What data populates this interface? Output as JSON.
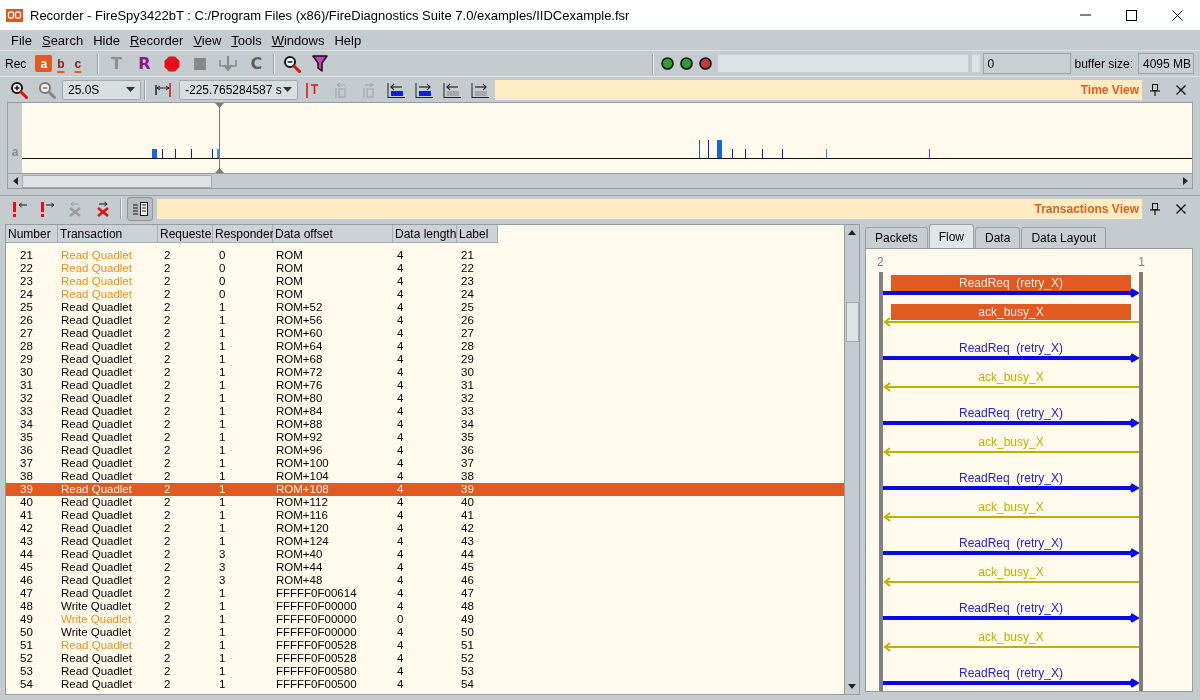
{
  "window": {
    "title": "Recorder - FireSpy3422bT : C:/Program Files (x86)/FireDiagnostics Suite 7.0/examples/IIDCexample.fsr"
  },
  "menu": [
    {
      "label": "File",
      "underlined": false
    },
    {
      "label": "Search",
      "underlined": true
    },
    {
      "label": "Hide",
      "underlined": false
    },
    {
      "label": "Recorder",
      "underlined": true
    },
    {
      "label": "View",
      "underlined": true
    },
    {
      "label": "Tools",
      "underlined": true
    },
    {
      "label": "Windows",
      "underlined": true
    },
    {
      "label": "Help",
      "underlined": false
    }
  ],
  "record_toolbar": {
    "label": "Rec",
    "channels": [
      {
        "label": "a",
        "selected": true
      },
      {
        "label": "b",
        "selected": false
      },
      {
        "label": "c",
        "selected": false
      }
    ],
    "tools": [
      {
        "kind": "letter",
        "label": "T",
        "color": "#8e8e8e"
      },
      {
        "kind": "letter",
        "label": "R",
        "color": "#86198a"
      },
      {
        "kind": "record"
      },
      {
        "kind": "stop"
      },
      {
        "kind": "download"
      },
      {
        "kind": "letter",
        "label": "C",
        "color": "#5c5c5c"
      },
      {
        "kind": "separator"
      },
      {
        "kind": "search"
      },
      {
        "kind": "filter"
      }
    ]
  },
  "status": {
    "leds": [
      {
        "color": "#2f9e35"
      },
      {
        "color": "#2f9e35"
      },
      {
        "color": "#c03a3a"
      }
    ],
    "counter": "0",
    "buffer_label": "buffer size:",
    "buffer_value": "4095 MB"
  },
  "time_view": {
    "zoom": "25.0S",
    "position": "-225.765284587 s",
    "title": "Time View",
    "track_label": "a"
  },
  "transactions": {
    "title": "Transactions View",
    "columns": [
      "Number",
      "Transaction",
      "Requeste",
      "Responder",
      "Data offset",
      "Data length",
      "Label"
    ],
    "rows": [
      {
        "cells": [
          "21",
          "Read Quadlet",
          "2",
          "0",
          "ROM",
          "4",
          "21"
        ],
        "kind": "retry",
        "selected": false
      },
      {
        "cells": [
          "22",
          "Read Quadlet",
          "2",
          "0",
          "ROM",
          "4",
          "22"
        ],
        "kind": "retry",
        "selected": false
      },
      {
        "cells": [
          "23",
          "Read Quadlet",
          "2",
          "0",
          "ROM",
          "4",
          "23"
        ],
        "kind": "retry",
        "selected": false
      },
      {
        "cells": [
          "24",
          "Read Quadlet",
          "2",
          "0",
          "ROM",
          "4",
          "24"
        ],
        "kind": "retry",
        "selected": false
      },
      {
        "cells": [
          "25",
          "Read Quadlet",
          "2",
          "1",
          "ROM+52",
          "4",
          "25"
        ],
        "kind": "normal",
        "selected": false
      },
      {
        "cells": [
          "26",
          "Read Quadlet",
          "2",
          "1",
          "ROM+56",
          "4",
          "26"
        ],
        "kind": "normal",
        "selected": false
      },
      {
        "cells": [
          "27",
          "Read Quadlet",
          "2",
          "1",
          "ROM+60",
          "4",
          "27"
        ],
        "kind": "normal",
        "selected": false
      },
      {
        "cells": [
          "28",
          "Read Quadlet",
          "2",
          "1",
          "ROM+64",
          "4",
          "28"
        ],
        "kind": "normal",
        "selected": false
      },
      {
        "cells": [
          "29",
          "Read Quadlet",
          "2",
          "1",
          "ROM+68",
          "4",
          "29"
        ],
        "kind": "normal",
        "selected": false
      },
      {
        "cells": [
          "30",
          "Read Quadlet",
          "2",
          "1",
          "ROM+72",
          "4",
          "30"
        ],
        "kind": "normal",
        "selected": false
      },
      {
        "cells": [
          "31",
          "Read Quadlet",
          "2",
          "1",
          "ROM+76",
          "4",
          "31"
        ],
        "kind": "normal",
        "selected": false
      },
      {
        "cells": [
          "32",
          "Read Quadlet",
          "2",
          "1",
          "ROM+80",
          "4",
          "32"
        ],
        "kind": "normal",
        "selected": false
      },
      {
        "cells": [
          "33",
          "Read Quadlet",
          "2",
          "1",
          "ROM+84",
          "4",
          "33"
        ],
        "kind": "normal",
        "selected": false
      },
      {
        "cells": [
          "34",
          "Read Quadlet",
          "2",
          "1",
          "ROM+88",
          "4",
          "34"
        ],
        "kind": "normal",
        "selected": false
      },
      {
        "cells": [
          "35",
          "Read Quadlet",
          "2",
          "1",
          "ROM+92",
          "4",
          "35"
        ],
        "kind": "normal",
        "selected": false
      },
      {
        "cells": [
          "36",
          "Read Quadlet",
          "2",
          "1",
          "ROM+96",
          "4",
          "36"
        ],
        "kind": "normal",
        "selected": false
      },
      {
        "cells": [
          "37",
          "Read Quadlet",
          "2",
          "1",
          "ROM+100",
          "4",
          "37"
        ],
        "kind": "normal",
        "selected": false
      },
      {
        "cells": [
          "38",
          "Read Quadlet",
          "2",
          "1",
          "ROM+104",
          "4",
          "38"
        ],
        "kind": "normal",
        "selected": false
      },
      {
        "cells": [
          "39",
          "Read Quadlet",
          "2",
          "1",
          "ROM+108",
          "4",
          "39"
        ],
        "kind": "normal",
        "selected": true
      },
      {
        "cells": [
          "40",
          "Read Quadlet",
          "2",
          "1",
          "ROM+112",
          "4",
          "40"
        ],
        "kind": "normal",
        "selected": false
      },
      {
        "cells": [
          "41",
          "Read Quadlet",
          "2",
          "1",
          "ROM+116",
          "4",
          "41"
        ],
        "kind": "normal",
        "selected": false
      },
      {
        "cells": [
          "42",
          "Read Quadlet",
          "2",
          "1",
          "ROM+120",
          "4",
          "42"
        ],
        "kind": "normal",
        "selected": false
      },
      {
        "cells": [
          "43",
          "Read Quadlet",
          "2",
          "1",
          "ROM+124",
          "4",
          "43"
        ],
        "kind": "normal",
        "selected": false
      },
      {
        "cells": [
          "44",
          "Read Quadlet",
          "2",
          "3",
          "ROM+40",
          "4",
          "44"
        ],
        "kind": "normal",
        "selected": false
      },
      {
        "cells": [
          "45",
          "Read Quadlet",
          "2",
          "3",
          "ROM+44",
          "4",
          "45"
        ],
        "kind": "normal",
        "selected": false
      },
      {
        "cells": [
          "46",
          "Read Quadlet",
          "2",
          "3",
          "ROM+48",
          "4",
          "46"
        ],
        "kind": "normal",
        "selected": false
      },
      {
        "cells": [
          "47",
          "Read Quadlet",
          "2",
          "1",
          "FFFFF0F00614",
          "4",
          "47"
        ],
        "kind": "normal",
        "selected": false
      },
      {
        "cells": [
          "48",
          "Write Quadlet",
          "2",
          "1",
          "FFFFF0F00000",
          "4",
          "48"
        ],
        "kind": "normal",
        "selected": false
      },
      {
        "cells": [
          "49",
          "Write Quadlet",
          "2",
          "1",
          "FFFFF0F00000",
          "0",
          "49"
        ],
        "kind": "retry",
        "selected": false
      },
      {
        "cells": [
          "50",
          "Write Quadlet",
          "2",
          "1",
          "FFFFF0F00000",
          "4",
          "50"
        ],
        "kind": "normal",
        "selected": false
      },
      {
        "cells": [
          "51",
          "Read Quadlet",
          "2",
          "1",
          "FFFFF0F00528",
          "4",
          "51"
        ],
        "kind": "retry",
        "selected": false
      },
      {
        "cells": [
          "52",
          "Read Quadlet",
          "2",
          "1",
          "FFFFF0F00528",
          "4",
          "52"
        ],
        "kind": "normal",
        "selected": false
      },
      {
        "cells": [
          "53",
          "Read Quadlet",
          "2",
          "1",
          "FFFFF0F00580",
          "4",
          "53"
        ],
        "kind": "normal",
        "selected": false
      },
      {
        "cells": [
          "54",
          "Read Quadlet",
          "2",
          "1",
          "FFFFF0F00500",
          "4",
          "54"
        ],
        "kind": "normal",
        "selected": false
      }
    ]
  },
  "detail": {
    "tabs": [
      {
        "label": "Packets",
        "selected": false
      },
      {
        "label": "Flow",
        "selected": true
      },
      {
        "label": "Data",
        "selected": false
      },
      {
        "label": "Data Layout",
        "selected": false
      }
    ],
    "flow": {
      "nodes": [
        {
          "label": "2"
        },
        {
          "label": "1"
        }
      ],
      "messages": [
        {
          "kind": "request",
          "label": "ReadReq  (retry_X)",
          "selected": true
        },
        {
          "kind": "response",
          "label": "ack_busy_X",
          "selected": true
        },
        {
          "kind": "request",
          "label": "ReadReq  (retry_X)",
          "selected": false
        },
        {
          "kind": "response",
          "label": "ack_busy_X",
          "selected": false
        },
        {
          "kind": "request",
          "label": "ReadReq  (retry_X)",
          "selected": false
        },
        {
          "kind": "response",
          "label": "ack_busy_X",
          "selected": false
        },
        {
          "kind": "request",
          "label": "ReadReq  (retry_X)",
          "selected": false
        },
        {
          "kind": "response",
          "label": "ack_busy_X",
          "selected": false
        },
        {
          "kind": "request",
          "label": "ReadReq  (retry_X)",
          "selected": false
        },
        {
          "kind": "response",
          "label": "ack_busy_X",
          "selected": false
        },
        {
          "kind": "request",
          "label": "ReadReq  (retry_X)",
          "selected": false
        },
        {
          "kind": "response",
          "label": "ack_busy_X",
          "selected": false
        },
        {
          "kind": "request",
          "label": "ReadReq  (retry_X)",
          "selected": false
        }
      ]
    }
  }
}
